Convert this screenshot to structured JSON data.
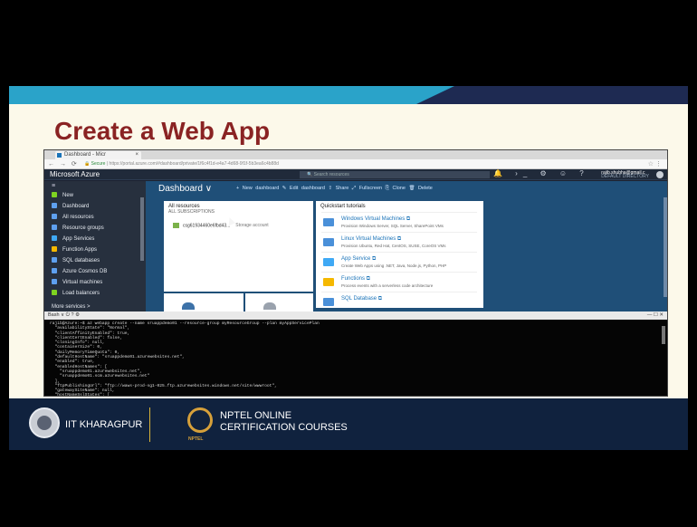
{
  "slide": {
    "title": "Create a Web App",
    "colors": {
      "band": "#2aa3c9",
      "band_dark": "#1e2a52",
      "title": "#8a2323",
      "footer": "#10223e"
    }
  },
  "browser": {
    "tab_title": "Dashboard - Micr",
    "url_secure": "Secure",
    "url": "https://portal.azure.com/#dashboard/private/1f6c4f1d-e4a7-4d68-9f1f-5b3ea6c4b88d",
    "nav_icons": "← → ⟳"
  },
  "azure": {
    "brand": "Microsoft Azure",
    "search_placeholder": "Search resources",
    "user_email": "rajib.shubha@gmail.c",
    "user_tenant": "DEFAULT DIRECTORY",
    "sidebar_collapse": "≡",
    "sidebar": [
      {
        "label": "New",
        "icon": "plus-icon",
        "color": "#7ed321"
      },
      {
        "label": "Dashboard",
        "icon": "dashboard-icon",
        "color": "#5ea0ef"
      },
      {
        "label": "All resources",
        "icon": "grid-icon",
        "color": "#5ea0ef"
      },
      {
        "label": "Resource groups",
        "icon": "cube-icon",
        "color": "#5ea0ef"
      },
      {
        "label": "App Services",
        "icon": "globe-icon",
        "color": "#3fa9f5"
      },
      {
        "label": "Function Apps",
        "icon": "bolt-icon",
        "color": "#f5b800"
      },
      {
        "label": "SQL databases",
        "icon": "database-icon",
        "color": "#5ea0ef"
      },
      {
        "label": "Azure Cosmos DB",
        "icon": "planet-icon",
        "color": "#5ea0ef"
      },
      {
        "label": "Virtual machines",
        "icon": "monitor-icon",
        "color": "#5ea0ef"
      },
      {
        "label": "Load balancers",
        "icon": "balance-icon",
        "color": "#7ed321"
      }
    ],
    "more_services": "More services >",
    "dashboard": {
      "title": "Dashboard",
      "actions": "+ New dashboard   ✎ Edit dashboard   ⇪ Share   ⤢ Fullscreen   ⎘ Clone   🗑 Delete",
      "all_resources_title": "All resources",
      "all_resources_sub": "ALL SUBSCRIPTIONS",
      "resource_name": "csg61934460e6fbd43...",
      "resource_type": "Storage account",
      "quickstart_title": "Quickstart tutorials",
      "quickstart": [
        {
          "title": "Windows Virtual Machines ⧉",
          "desc": "Provision Windows Server, SQL Server, SharePoint VMs",
          "color": "#4a90d9"
        },
        {
          "title": "Linux Virtual Machines ⧉",
          "desc": "Provision Ubuntu, Red Hat, CentOS, SUSE, CoreOS VMs",
          "color": "#4a90d9"
        },
        {
          "title": "App Service ⧉",
          "desc": "Create Web Apps using .NET, Java, Node.js, Python, PHP",
          "color": "#3fa9f5"
        },
        {
          "title": "Functions ⧉",
          "desc": "Process events with a serverless code architecture",
          "color": "#f5b800"
        },
        {
          "title": "SQL Database ⧉",
          "desc": "",
          "color": "#4a90d9"
        }
      ]
    },
    "terminal_bar": "Bash  ∨   ⏻   ?   ⚙",
    "terminal_bar_right": "—  ☐  ✕",
    "terminal_lines": "rajib@Azure:~$ az webapp create --name sruappdemo01 --resource-group myResourceGroup --plan myAppServicePlan\n  \"availabilityState\": \"Normal\",\n  \"clientAffinityEnabled\": true,\n  \"clientCertEnabled\": false,\n  \"cloningInfo\": null,\n  \"containerSize\": 0,\n  \"dailyMemoryTimeQuota\": 0,\n  \"defaultHostName\": \"sruappdemo01.azurewebsites.net\",\n  \"enabled\": true,\n  \"enabledHostNames\": [\n    \"sruappdemo01.azurewebsites.net\",\n    \"sruappdemo01.scm.azurewebsites.net\"\n  ],\n  \"ftpPublishingUrl\": \"ftp://waws-prod-sg1-025.ftp.azurewebsites.windows.net/site/wwwroot\",\n  \"gatewaySiteName\": null,\n  \"hostNameSslStates\": ["
  },
  "footer": {
    "iit": "IIT KHARAGPUR",
    "nptel_line1": "NPTEL ONLINE",
    "nptel_line2": "CERTIFICATION COURSES",
    "nptel_small": "NPTEL"
  }
}
